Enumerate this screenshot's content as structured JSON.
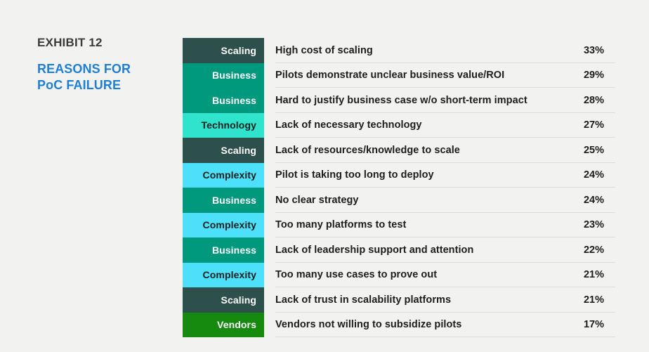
{
  "header": {
    "exhibit_label": "EXHIBIT 12",
    "title_line_1": "REASONS FOR",
    "title_line_2": "PoC FAILURE"
  },
  "colors": {
    "background": "#f2f2f1",
    "accent_blue": "#1f7fd4",
    "exhibit_gray": "#3a3a3a",
    "divider": "#dddddb",
    "Scaling": "#2d504c",
    "Business": "#00997e",
    "Technology": "#2fe3cc",
    "Complexity": "#4ce0fa",
    "Vendors": "#16890f"
  },
  "chart_data": {
    "type": "bar",
    "title": "REASONS FOR PoC FAILURE",
    "subtitle": "EXHIBIT 12",
    "xlabel": "",
    "ylabel": "",
    "grid": false,
    "legend": "none",
    "value_suffix": "%",
    "categories": [
      "High cost of scaling",
      "Pilots demonstrate unclear business value/ROI",
      "Hard to justify business case w/o short-term impact",
      "Lack of necessary technology",
      "Lack of resources/knowledge to scale",
      "Pilot is taking too long to deploy",
      "No clear strategy",
      "Too many platforms to test",
      "Lack of leadership support and attention",
      "Too many use cases to prove out",
      "Lack of trust in scalability platforms",
      "Vendors not willing to subsidize pilots"
    ],
    "values": [
      33,
      29,
      28,
      27,
      25,
      24,
      24,
      23,
      22,
      21,
      21,
      17
    ],
    "value_labels": [
      "33%",
      "29%",
      "28%",
      "27%",
      "25%",
      "24%",
      "24%",
      "23%",
      "22%",
      "21%",
      "21%",
      "17%"
    ],
    "groups": [
      "Scaling",
      "Business",
      "Business",
      "Technology",
      "Scaling",
      "Complexity",
      "Business",
      "Complexity",
      "Business",
      "Complexity",
      "Scaling",
      "Vendors"
    ],
    "group_names": [
      "Scaling",
      "Business",
      "Technology",
      "Complexity",
      "Vendors"
    ],
    "ylim": [
      0,
      35
    ]
  },
  "rows": [
    {
      "group": "Scaling",
      "label": "High cost of scaling",
      "value": "33%"
    },
    {
      "group": "Business",
      "label": "Pilots demonstrate unclear business value/ROI",
      "value": "29%"
    },
    {
      "group": "Business",
      "label": "Hard to justify business case w/o short-term impact",
      "value": "28%"
    },
    {
      "group": "Technology",
      "label": "Lack of necessary technology",
      "value": "27%"
    },
    {
      "group": "Scaling",
      "label": "Lack of resources/knowledge to scale",
      "value": "25%"
    },
    {
      "group": "Complexity",
      "label": "Pilot is taking too long to deploy",
      "value": "24%"
    },
    {
      "group": "Business",
      "label": "No clear strategy",
      "value": "24%"
    },
    {
      "group": "Complexity",
      "label": "Too many platforms to test",
      "value": "23%"
    },
    {
      "group": "Business",
      "label": "Lack of leadership support and attention",
      "value": "22%"
    },
    {
      "group": "Complexity",
      "label": "Too many use cases to prove out",
      "value": "21%"
    },
    {
      "group": "Scaling",
      "label": "Lack of trust in scalability platforms",
      "value": "21%"
    },
    {
      "group": "Vendors",
      "label": "Vendors not willing to subsidize pilots",
      "value": "17%"
    }
  ]
}
